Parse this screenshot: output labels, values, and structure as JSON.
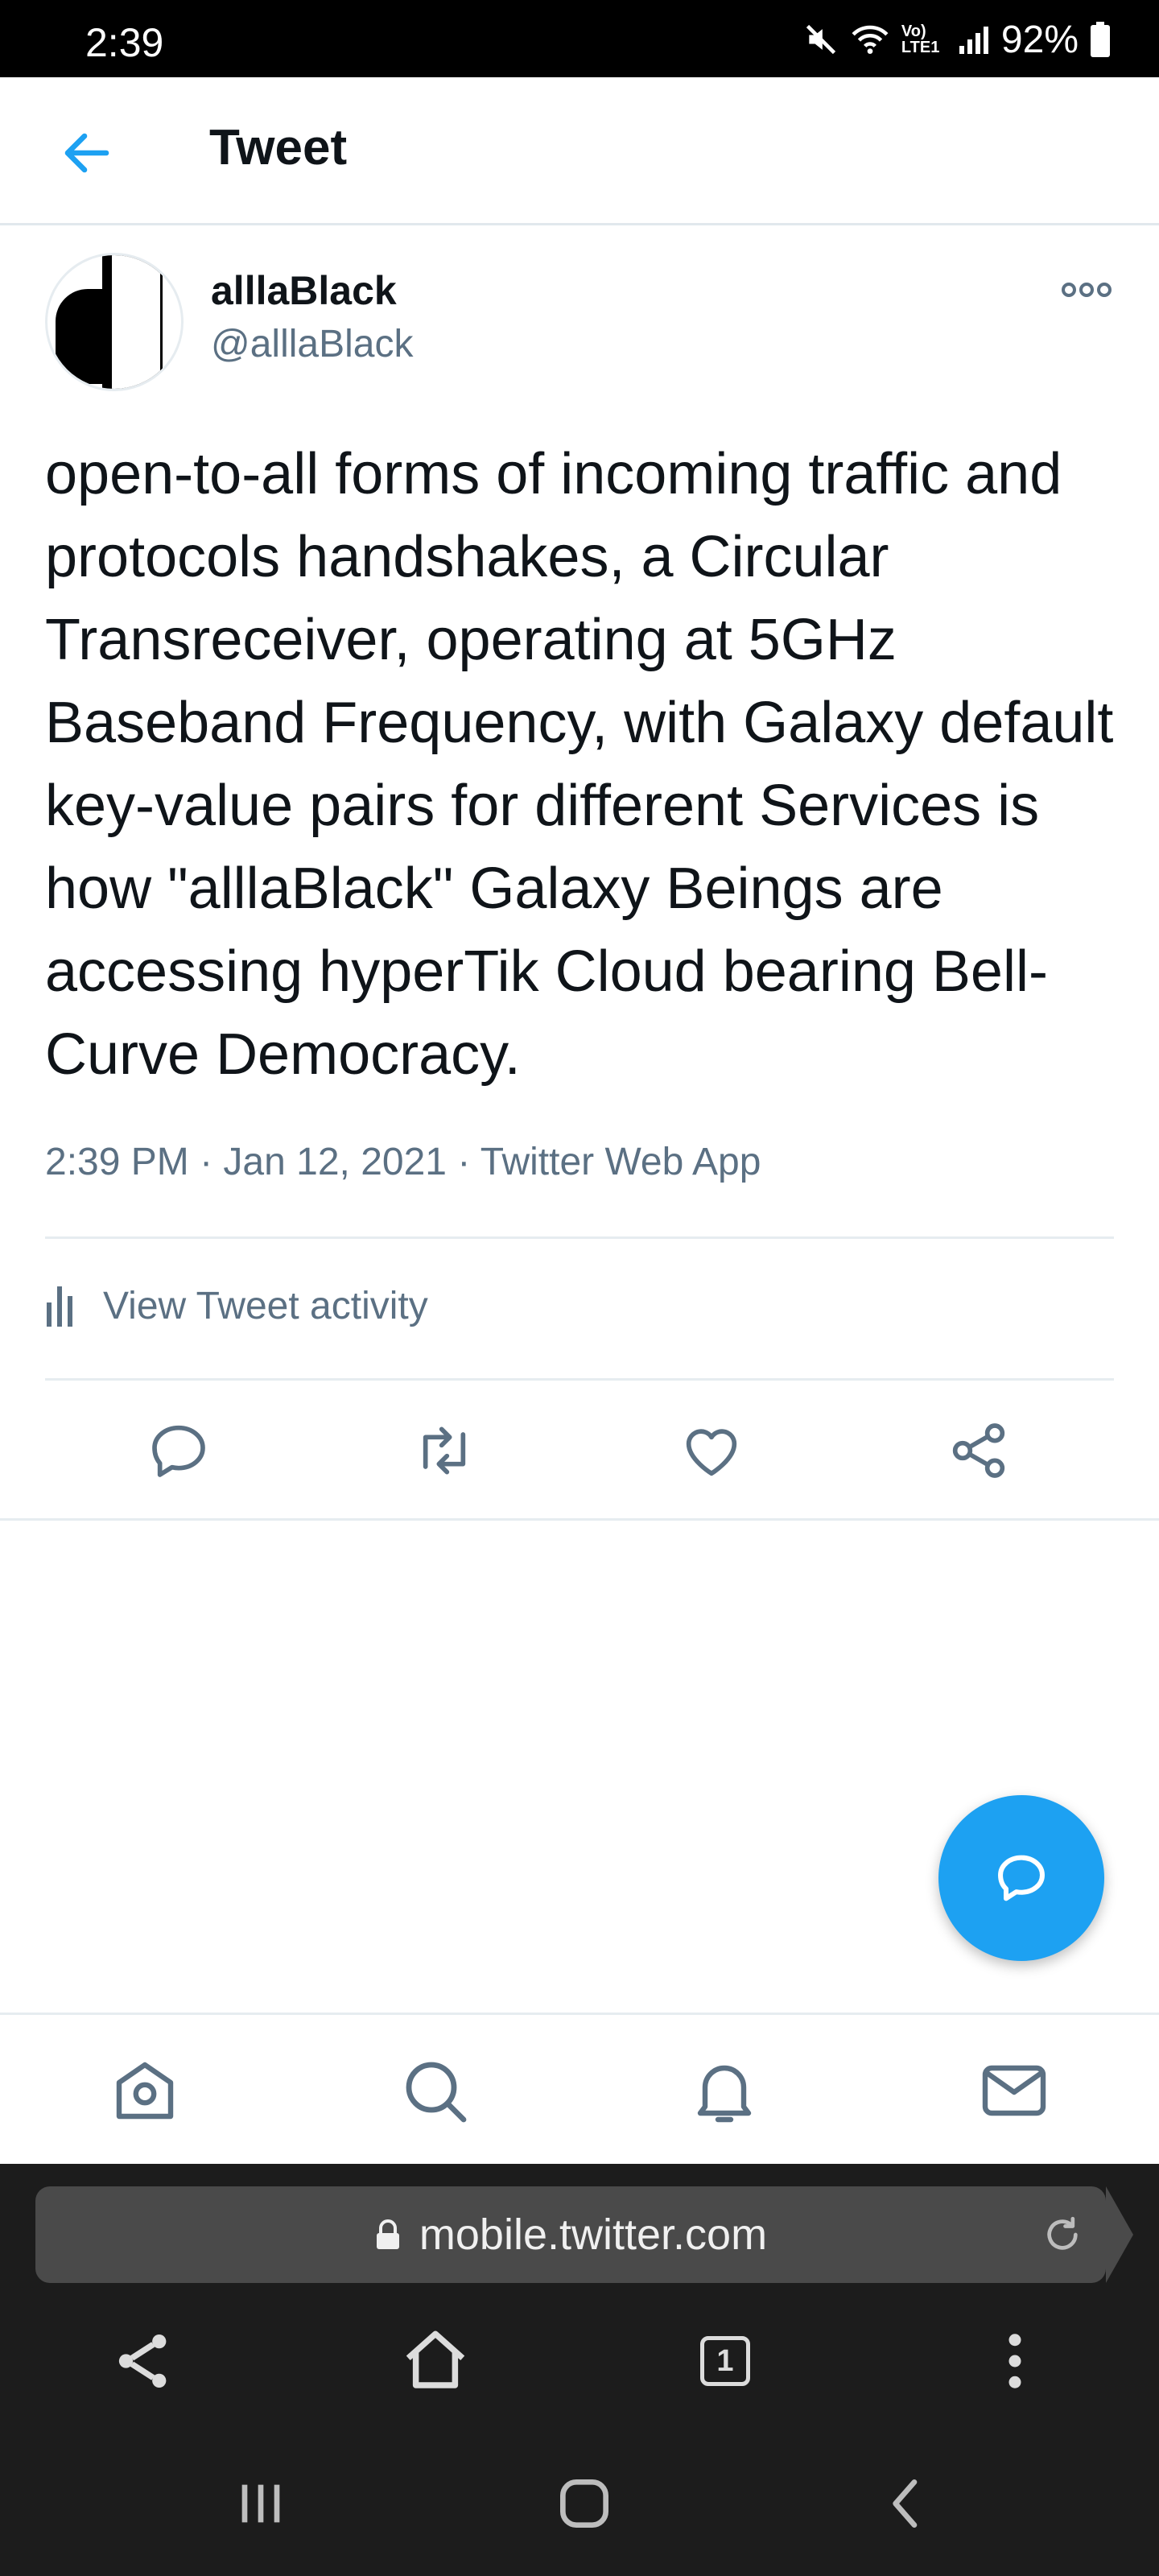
{
  "status_bar": {
    "time": "2:39",
    "network": "Vo) LTE1",
    "battery": "92%"
  },
  "header": {
    "title": "Tweet",
    "back_icon": "arrow-left-icon",
    "accent": "#1da1f2"
  },
  "tweet": {
    "display_name": "alllaBlack",
    "handle": "@alllaBlack",
    "text": "open-to-all forms of incoming traffic and protocols handshakes, a Circular Transreceiver, operating at 5GHz Baseband Frequency, with Galaxy default key-value pairs for different Services is how \"alllaBlack\" Galaxy Beings are accessing hyperTik Cloud bearing Bell-Curve Democracy.",
    "timestamp": "2:39 PM · Jan 12, 2021  · Twitter Web App",
    "activity_label": "View Tweet activity",
    "actions": [
      "reply-icon",
      "retweet-icon",
      "like-icon",
      "share-icon"
    ]
  },
  "fab": {
    "icon": "compose-reply-icon",
    "color": "#1da1f2"
  },
  "bottom_nav": [
    "home-icon",
    "search-icon",
    "notifications-icon",
    "messages-icon"
  ],
  "browser": {
    "url": "mobile.twitter.com",
    "tab_count": "1",
    "tools": [
      "share-icon",
      "home-icon",
      "tabs-icon",
      "menu-icon"
    ]
  },
  "system_nav": [
    "recent-apps-icon",
    "home-icon",
    "back-icon"
  ]
}
